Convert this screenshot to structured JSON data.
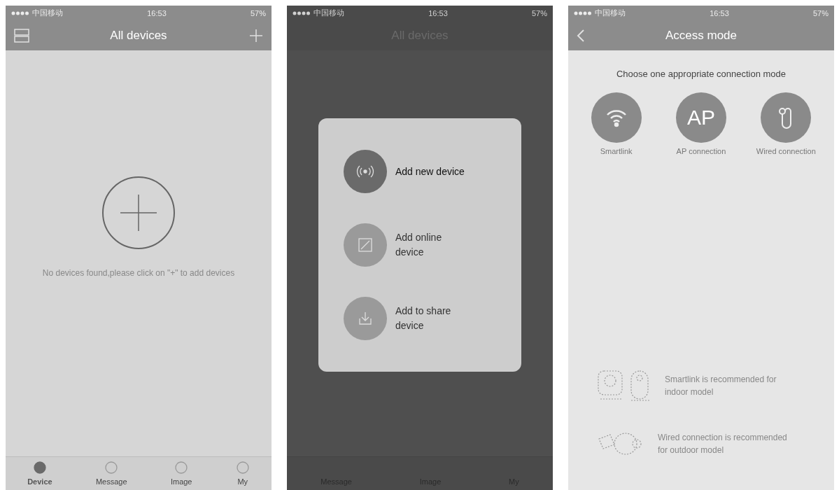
{
  "screens": [
    {
      "kind": "devices",
      "status": {
        "carrier": "中国移动",
        "time": "16:53",
        "battery": "57%"
      },
      "title": "All devices",
      "empty_text": "No devices found,please click on \"+\" to add devices",
      "tabs": [
        {
          "label": "Device",
          "selected": true
        },
        {
          "label": "Message",
          "selected": false
        },
        {
          "label": "Image",
          "selected": false
        },
        {
          "label": "My",
          "selected": false
        }
      ]
    },
    {
      "kind": "menu",
      "status": {
        "carrier": "中国移动",
        "time": "16:53",
        "battery": "57%"
      },
      "title": "All devices",
      "menu": [
        {
          "kind": "radar",
          "label": "Add new device",
          "active": true
        },
        {
          "kind": "online",
          "label": "Add online device",
          "active": false
        },
        {
          "kind": "share",
          "label": "Add to share device",
          "active": false
        }
      ],
      "tabs": [
        {
          "label": "Message",
          "selected": false
        },
        {
          "label": "Image",
          "selected": false
        },
        {
          "label": "My",
          "selected": false
        }
      ]
    },
    {
      "kind": "access",
      "status": {
        "carrier": "中国移动",
        "time": "16:53",
        "battery": "57%"
      },
      "title": "Access mode",
      "prompt": "Choose one appropriate connection mode",
      "modes": [
        {
          "kind": "wifi",
          "label": "Smartlink"
        },
        {
          "kind": "ap",
          "badge": "AP",
          "label": "AP connection"
        },
        {
          "kind": "wired",
          "label": "Wired connection"
        }
      ],
      "notes": [
        {
          "kind": "indoor",
          "text": "Smartlink is recommended for indoor model"
        },
        {
          "kind": "outdoor",
          "text": "Wired connection is recommended for outdoor model"
        }
      ]
    }
  ]
}
